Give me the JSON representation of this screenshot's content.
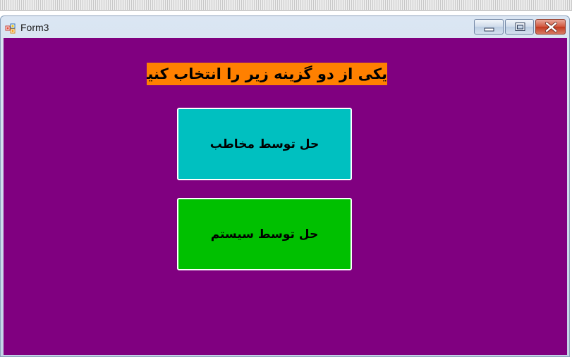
{
  "window": {
    "title": "Form3",
    "app_icon": "winforms-app-icon",
    "controls": {
      "minimize_icon": "minimize-icon",
      "maximize_icon": "maximize-icon",
      "close_icon": "close-icon"
    }
  },
  "form": {
    "background_color": "#800080",
    "prompt": {
      "text": "یکی از دو گزینه زیر را انتخاب کنید",
      "background_color": "#FF8000"
    },
    "buttons": [
      {
        "label": "حل توسط مخاطب",
        "background_color": "#00C0C0"
      },
      {
        "label": "حل توسط سیستم",
        "background_color": "#00C000"
      }
    ]
  }
}
